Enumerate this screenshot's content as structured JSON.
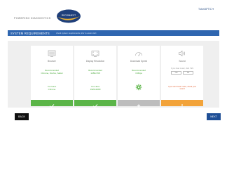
{
  "header": {
    "brand": "POWERING DIAGNOSTICS",
    "logo_text": "RECONNECT",
    "user": "Tutor/APTIC"
  },
  "banner": {
    "title": "SYSTEM REQUIREMENTS",
    "subtitle": "check system requirements prior to exam start"
  },
  "cards": [
    {
      "icon": "monitor-icon",
      "title": "Browser",
      "recommended_label": "Recommended",
      "recommended_value": "Chrome, Firefox, Safari",
      "have_label": "You Have",
      "have_value": "Chrome",
      "status": "ok",
      "status_icon": "checkmark-icon",
      "status_glyph": "✓"
    },
    {
      "icon": "display-icon",
      "title": "Display Resolution",
      "recommended_label": "Recommended",
      "recommended_value": "1280x768",
      "have_label": "You Have",
      "have_value": "1920x1080",
      "status": "ok",
      "status_icon": "checkmark-icon",
      "status_glyph": "✓"
    },
    {
      "icon": "speedometer-icon",
      "title": "Download Speed",
      "recommended_label": "Recommended",
      "recommended_value": "3 Mbps",
      "status": "neutral",
      "status_icon": "plus-icon",
      "status_glyph": "+"
    },
    {
      "icon": "speaker-icon",
      "title": "Sound",
      "question": "If you hear music, click YES",
      "yes_label": "Yes",
      "no_label": "No",
      "warning": "If you don't hear music, check your sound",
      "status": "warn",
      "status_icon": "exclamation-icon",
      "status_glyph": "!"
    }
  ],
  "buttons": {
    "back": "BACK",
    "next": "NEXT"
  },
  "colors": {
    "ok": "#5bb548",
    "neutral": "#bdbdbd",
    "warn": "#f2a33a",
    "accent": "#2f66b0",
    "dark": "#111111"
  }
}
